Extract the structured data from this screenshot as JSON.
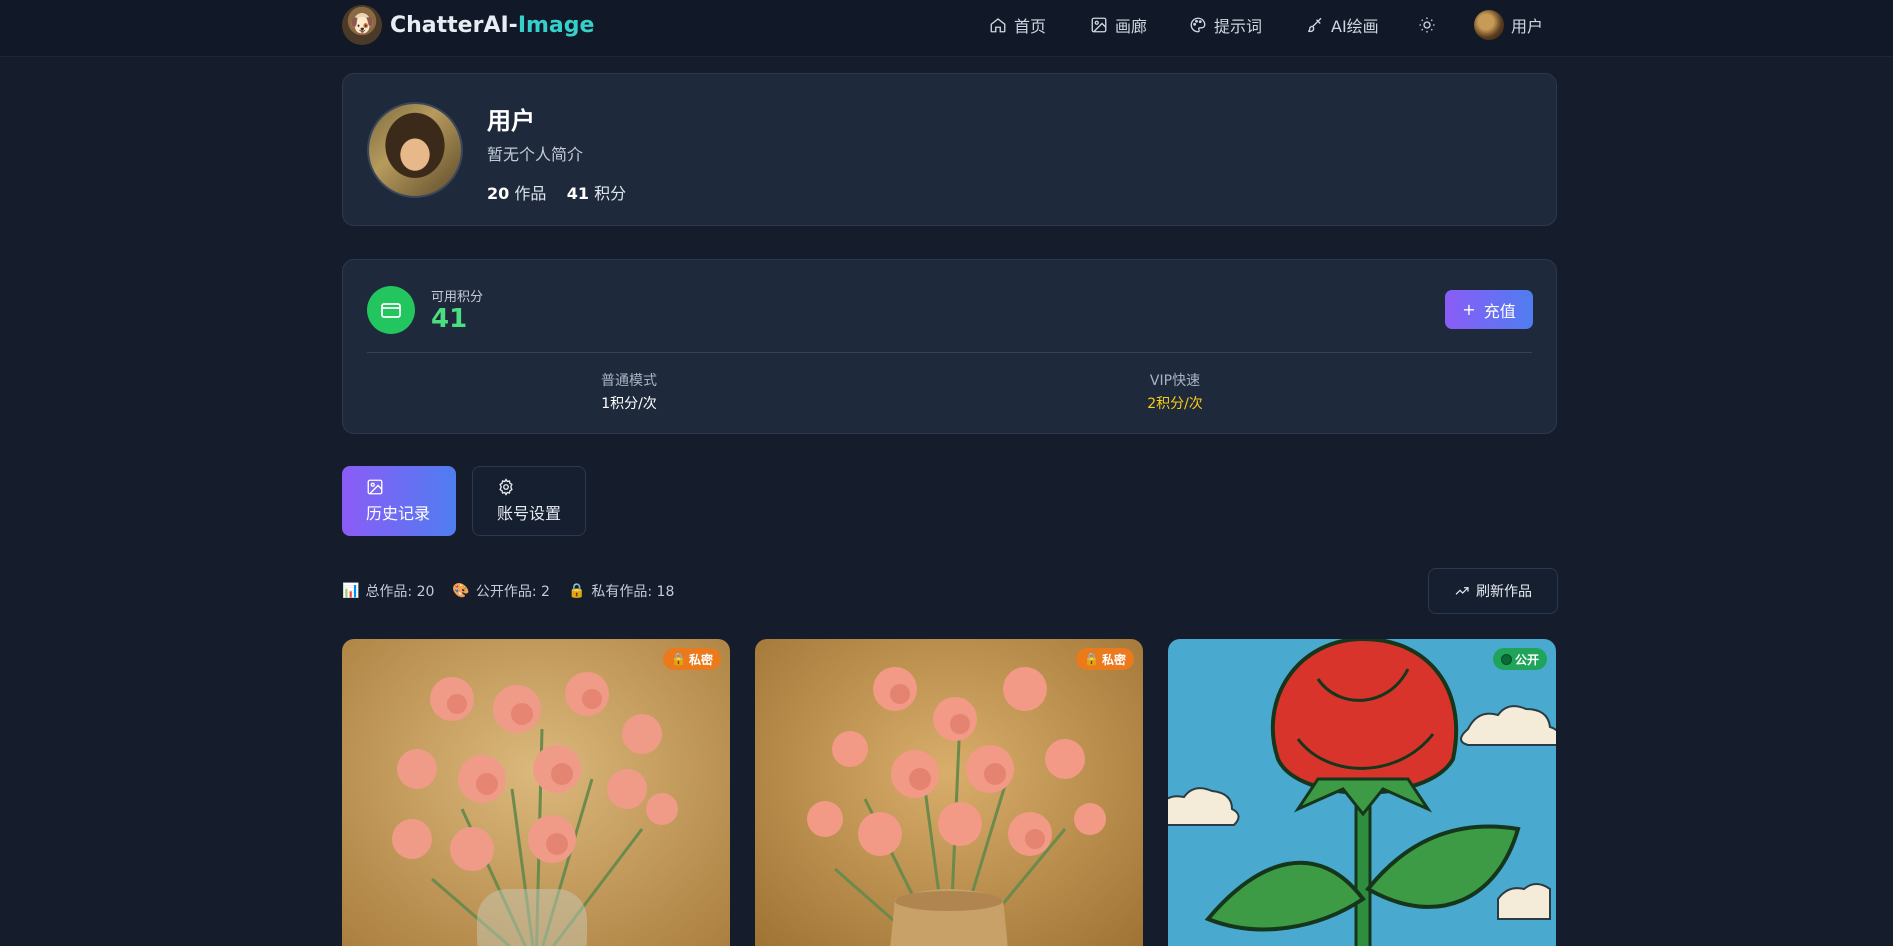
{
  "brand": {
    "name_main": "ChatterAI-",
    "name_accent": "Image"
  },
  "nav": {
    "items": [
      {
        "label": "首页",
        "icon": "home-icon"
      },
      {
        "label": "画廊",
        "icon": "image-icon"
      },
      {
        "label": "提示词",
        "icon": "palette-icon"
      },
      {
        "label": "AI绘画",
        "icon": "brush-icon"
      }
    ],
    "theme_icon": "sun-icon",
    "user_label": "用户"
  },
  "profile": {
    "name": "用户",
    "bio": "暂无个人简介",
    "works_count": "20",
    "works_label": "作品",
    "credits_count": "41",
    "credits_label": "积分"
  },
  "credits": {
    "label": "可用积分",
    "value": "41",
    "recharge_label": "充值",
    "modes": [
      {
        "label": "普通模式",
        "value": "1积分/次"
      },
      {
        "label": "VIP快速",
        "value": "2积分/次"
      }
    ]
  },
  "tabs": [
    {
      "label": "历史记录",
      "icon": "image-icon",
      "active": true
    },
    {
      "label": "账号设置",
      "icon": "gear-icon",
      "active": false
    }
  ],
  "stats": {
    "total": "总作品: 20",
    "public": "公开作品: 2",
    "private": "私有作品: 18",
    "refresh_label": "刷新作品"
  },
  "gallery": [
    {
      "badge": "私密",
      "visibility": "private",
      "subject": "pink carnations in glass vase"
    },
    {
      "badge": "私密",
      "visibility": "private",
      "subject": "pink carnations in ceramic vase"
    },
    {
      "badge": "公开",
      "visibility": "public",
      "subject": "red rose cartoon"
    }
  ],
  "colors": {
    "background": "#151d2c",
    "card": "#1e293b",
    "accent_green": "#4ade80",
    "accent_gradient_start": "#8b5cf6",
    "accent_gradient_end": "#4f7df0",
    "vip_yellow": "#facc15",
    "brand_accent": "#34d0c9"
  }
}
